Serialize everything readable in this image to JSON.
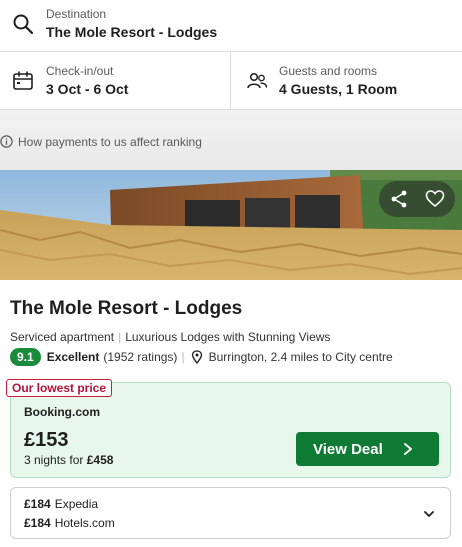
{
  "search": {
    "destination_label": "Destination",
    "destination_value": "The Mole Resort - Lodges"
  },
  "dates": {
    "label": "Check-in/out",
    "value": "3 Oct - 6 Oct"
  },
  "guests": {
    "label": "Guests and rooms",
    "value": "4 Guests, 1 Room"
  },
  "info": {
    "text": "How payments to us affect ranking"
  },
  "hero": {
    "image": "lodge-in-meadow-photo",
    "share_icon": "share-icon",
    "favorite_icon": "heart-icon"
  },
  "hotel": {
    "name": "The Mole Resort - Lodges",
    "type": "Serviced apartment",
    "tagline": "Luxurious Lodges with Stunning Views",
    "rating_score": "9.1",
    "rating_word": "Excellent",
    "rating_count": "(1952 ratings)",
    "location": "Burrington, 2.4 miles to City centre"
  },
  "deal": {
    "tag": "Our lowest price",
    "provider": "Booking.com",
    "price": "£153",
    "nights_text": "3 nights for",
    "total": "£458",
    "button_label": "View Deal"
  },
  "other_deals": [
    {
      "price": "£184",
      "provider": "Expedia"
    },
    {
      "price": "£184",
      "provider": "Hotels.com"
    }
  ],
  "colors": {
    "accent_green": "#0e7a33",
    "rating_green": "#1a8a3d",
    "deal_background": "#e8f7ec",
    "lowest_tag_red": "#b3133a"
  }
}
